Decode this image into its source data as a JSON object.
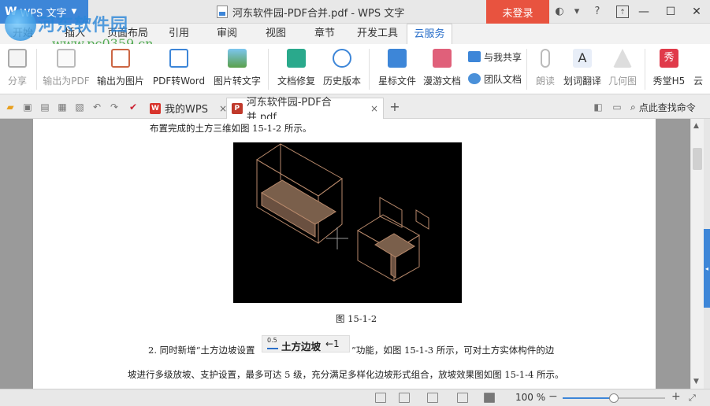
{
  "titlebar": {
    "app_logo": "W",
    "app_name": "WPS 文字",
    "doc_title": "河东软件园-PDF合并.pdf - WPS 文字",
    "login_label": "未登录",
    "icons": [
      "skin-icon",
      "shirt-icon",
      "help-icon",
      "restore-panel-icon"
    ]
  },
  "watermark": {
    "title": "河东软件园",
    "url": "www.pc0359.cn"
  },
  "ribbon_tabs": [
    {
      "label": "开始"
    },
    {
      "label": "插入"
    },
    {
      "label": "页面布局"
    },
    {
      "label": "引用"
    },
    {
      "label": "审阅"
    },
    {
      "label": "视图"
    },
    {
      "label": "章节"
    },
    {
      "label": "开发工具"
    },
    {
      "label": "云服务"
    }
  ],
  "ribbon": {
    "share": "分享",
    "export_pdf": "输出为PDF",
    "export_image": "输出为图片",
    "pdf_to_word": "PDF转Word",
    "image_to_text": "图片转文字",
    "doc_repair": "文档修复",
    "history": "历史版本",
    "star_file": "星标文件",
    "roam_doc": "漫游文档",
    "shared_with_me": "与我共享",
    "team_doc": "团队文档",
    "read_aloud": "朗读",
    "translate": "划词翻译",
    "geometry": "几何图",
    "h5": "秀堂H5",
    "more": "云"
  },
  "doctabs": {
    "tab1": "我的WPS",
    "tab2": "河东软件园-PDF合并.pdf",
    "add": "+",
    "close": "×",
    "find_cmd": "点此查找命令"
  },
  "document": {
    "line1": "布置完成的土方三维如图 15-1-2 所示。",
    "caption": "图 15-1-2",
    "para2_a": "2. 同时新增“土方边坡设置",
    "para2_b": "”功能，如图 15-1-3 所示，可对土方实体构件的边",
    "inline_num": "0.5",
    "inline_name": "土方边坡",
    "inline_arrow": "←1",
    "para3": "坡进行多级放坡、支护设置，最多可达 5 级，充分满足多样化边坡形式组合，放坡效果图如图 15-1-4 所示。"
  },
  "statusbar": {
    "zoom_label": "100 %",
    "zoom_value": 0.5
  },
  "colors": {
    "accent": "#3d86d8",
    "login": "#e8533f",
    "figure_bg": "#000000",
    "wireframe": "#b8896b"
  }
}
